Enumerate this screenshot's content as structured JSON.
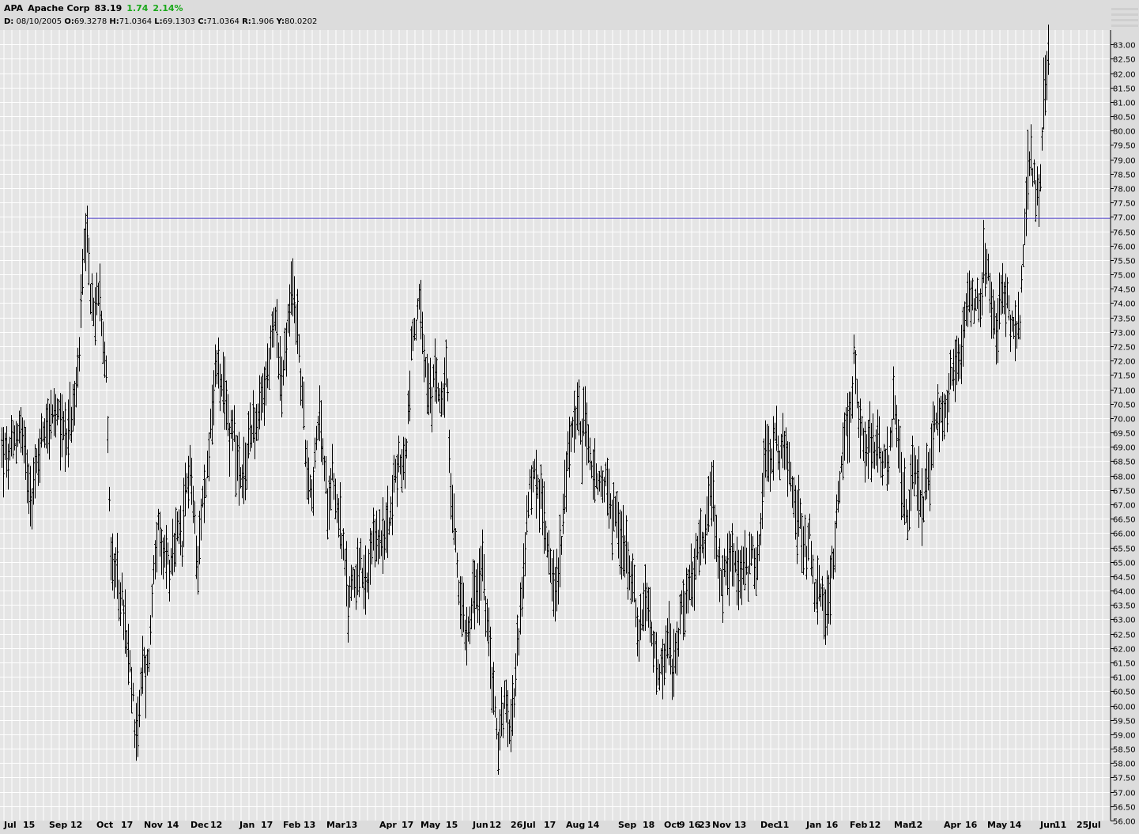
{
  "header": {
    "symbol": "APA",
    "name": "Apache Corp",
    "last": "83.19",
    "change": "1.74",
    "change_pct": "2.14%",
    "change_color": "#1aa81a",
    "ohlc": {
      "d_label": "D:",
      "d": "08/10/2005",
      "o_label": "O:",
      "o": "69.3278",
      "h_label": "H:",
      "h": "71.0364",
      "l_label": "L:",
      "l": "69.1303",
      "c_label": "C:",
      "c": "71.0364",
      "r_label": "R:",
      "r": "1.906",
      "y_label": "Y:",
      "y": "80.0202"
    }
  },
  "chart_data": {
    "type": "bar",
    "subtype": "ohlc",
    "ylim": [
      56.0,
      83.5
    ],
    "y_ticks": [
      "56.00",
      "56.50",
      "57.00",
      "57.50",
      "58.00",
      "58.50",
      "59.00",
      "59.50",
      "60.00",
      "60.50",
      "61.00",
      "61.50",
      "62.00",
      "62.50",
      "63.00",
      "63.50",
      "64.00",
      "64.50",
      "65.00",
      "65.50",
      "66.00",
      "66.50",
      "67.00",
      "67.50",
      "68.00",
      "68.50",
      "69.00",
      "69.50",
      "70.00",
      "70.50",
      "71.00",
      "71.50",
      "72.00",
      "72.50",
      "73.00",
      "73.50",
      "74.00",
      "74.50",
      "75.00",
      "75.50",
      "76.00",
      "76.50",
      "77.00",
      "77.50",
      "78.00",
      "78.50",
      "79.00",
      "79.50",
      "80.00",
      "80.50",
      "81.00",
      "81.50",
      "82.00",
      "82.50",
      "83.00"
    ],
    "x_tick_labels": [
      "Jul",
      "15",
      "Sep",
      "12",
      "Oct",
      "17",
      "Nov",
      "14",
      "Dec",
      "12",
      "Jan",
      "17",
      "Feb",
      "13",
      "Mar",
      "13",
      "Apr",
      "17",
      "May",
      "15",
      "Jun",
      "12",
      "26",
      "Jul",
      "17",
      "Aug",
      "14",
      "Sep",
      "18",
      "Oct",
      "9",
      "16",
      "23",
      "Nov",
      "13",
      "Dec",
      "11",
      "Jan",
      "16",
      "Feb",
      "12",
      "Mar",
      "12",
      "Apr",
      "16",
      "May",
      "14",
      "Jun",
      "11",
      "25",
      "Jul"
    ],
    "grid": true,
    "legend": "none",
    "resistance_line": {
      "value": 76.95,
      "color": "#4b3cc8"
    },
    "series_anchors": [
      [
        0,
        69.0
      ],
      [
        10,
        68.5
      ],
      [
        25,
        69.8
      ],
      [
        40,
        67.3
      ],
      [
        55,
        69.8
      ],
      [
        70,
        70.0
      ],
      [
        85,
        69.5
      ],
      [
        95,
        70.5
      ],
      [
        100,
        72.5
      ],
      [
        105,
        75.5
      ],
      [
        110,
        76.0
      ],
      [
        115,
        74.0
      ],
      [
        120,
        73.5
      ],
      [
        125,
        75.0
      ],
      [
        130,
        73.0
      ],
      [
        135,
        71.0
      ],
      [
        140,
        65.0
      ],
      [
        145,
        64.5
      ],
      [
        150,
        64.0
      ],
      [
        155,
        63.5
      ],
      [
        160,
        62.0
      ],
      [
        165,
        61.0
      ],
      [
        170,
        59.5
      ],
      [
        175,
        59.2
      ],
      [
        180,
        61.5
      ],
      [
        185,
        61.0
      ],
      [
        190,
        62.5
      ],
      [
        195,
        65.5
      ],
      [
        200,
        66.0
      ],
      [
        205,
        65.0
      ],
      [
        210,
        65.5
      ],
      [
        215,
        64.5
      ],
      [
        220,
        65.3
      ],
      [
        225,
        66.0
      ],
      [
        230,
        65.5
      ],
      [
        235,
        67.5
      ],
      [
        240,
        68.5
      ],
      [
        245,
        66.5
      ],
      [
        250,
        65.2
      ],
      [
        255,
        67.0
      ],
      [
        260,
        67.5
      ],
      [
        265,
        69.5
      ],
      [
        270,
        70.8
      ],
      [
        275,
        72.3
      ],
      [
        280,
        70.8
      ],
      [
        285,
        70.5
      ],
      [
        290,
        69.5
      ],
      [
        295,
        70.0
      ],
      [
        300,
        68.2
      ],
      [
        305,
        67.5
      ],
      [
        310,
        68.0
      ],
      [
        315,
        69.5
      ],
      [
        320,
        70.0
      ],
      [
        325,
        69.5
      ],
      [
        330,
        70.5
      ],
      [
        335,
        71.0
      ],
      [
        340,
        72.0
      ],
      [
        345,
        73.0
      ],
      [
        350,
        73.5
      ],
      [
        355,
        71.0
      ],
      [
        360,
        72.0
      ],
      [
        365,
        73.5
      ],
      [
        370,
        74.5
      ],
      [
        375,
        73.5
      ],
      [
        380,
        71.5
      ],
      [
        385,
        69.5
      ],
      [
        390,
        68.0
      ],
      [
        395,
        67.5
      ],
      [
        400,
        69.0
      ],
      [
        405,
        70.2
      ],
      [
        410,
        68.0
      ],
      [
        415,
        67.0
      ],
      [
        420,
        68.5
      ],
      [
        425,
        67.0
      ],
      [
        430,
        66.5
      ],
      [
        435,
        65.0
      ],
      [
        440,
        63.5
      ],
      [
        445,
        64.5
      ],
      [
        450,
        64.5
      ],
      [
        455,
        65.0
      ],
      [
        460,
        64.0
      ],
      [
        465,
        64.2
      ],
      [
        470,
        65.2
      ],
      [
        475,
        66.0
      ],
      [
        480,
        65.8
      ],
      [
        485,
        65.5
      ],
      [
        490,
        66.5
      ],
      [
        495,
        67.0
      ],
      [
        500,
        68.0
      ],
      [
        505,
        68.5
      ],
      [
        510,
        68.2
      ],
      [
        515,
        69.5
      ],
      [
        520,
        72.5
      ],
      [
        525,
        73.2
      ],
      [
        530,
        74.0
      ],
      [
        535,
        72.5
      ],
      [
        540,
        71.0
      ],
      [
        545,
        70.5
      ],
      [
        550,
        71.5
      ],
      [
        555,
        71.0
      ],
      [
        560,
        70.8
      ],
      [
        565,
        71.5
      ],
      [
        570,
        67.0
      ],
      [
        575,
        66.0
      ],
      [
        580,
        64.0
      ],
      [
        585,
        63.5
      ],
      [
        590,
        62.5
      ],
      [
        595,
        63.5
      ],
      [
        600,
        64.0
      ],
      [
        605,
        63.8
      ],
      [
        610,
        65.0
      ],
      [
        615,
        63.0
      ],
      [
        620,
        61.5
      ],
      [
        625,
        60.5
      ],
      [
        630,
        58.2
      ],
      [
        635,
        60.0
      ],
      [
        640,
        59.8
      ],
      [
        645,
        59.5
      ],
      [
        650,
        60.5
      ],
      [
        655,
        62.5
      ],
      [
        660,
        63.5
      ],
      [
        665,
        66.0
      ],
      [
        670,
        67.5
      ],
      [
        675,
        68.2
      ],
      [
        680,
        67.5
      ],
      [
        685,
        67.0
      ],
      [
        690,
        66.2
      ],
      [
        695,
        65.5
      ],
      [
        700,
        64.0
      ],
      [
        705,
        64.2
      ],
      [
        710,
        66.0
      ],
      [
        715,
        67.5
      ],
      [
        720,
        69.0
      ],
      [
        725,
        70.0
      ],
      [
        730,
        70.5
      ],
      [
        735,
        69.0
      ],
      [
        740,
        70.5
      ],
      [
        745,
        68.5
      ],
      [
        750,
        68.2
      ],
      [
        755,
        67.5
      ],
      [
        760,
        67.5
      ],
      [
        765,
        68.0
      ],
      [
        770,
        67.0
      ],
      [
        775,
        66.5
      ],
      [
        780,
        67.0
      ],
      [
        785,
        65.5
      ],
      [
        790,
        65.5
      ],
      [
        795,
        65.0
      ],
      [
        800,
        64.5
      ],
      [
        805,
        63.0
      ],
      [
        810,
        62.5
      ],
      [
        815,
        63.3
      ],
      [
        820,
        63.5
      ],
      [
        825,
        62.0
      ],
      [
        830,
        61.5
      ],
      [
        835,
        61.0
      ],
      [
        840,
        61.3
      ],
      [
        845,
        62.5
      ],
      [
        850,
        61.2
      ],
      [
        855,
        61.5
      ],
      [
        860,
        63.0
      ],
      [
        865,
        63.5
      ],
      [
        870,
        64.0
      ],
      [
        875,
        64.3
      ],
      [
        880,
        65.0
      ],
      [
        885,
        65.3
      ],
      [
        890,
        65.5
      ],
      [
        895,
        67.0
      ],
      [
        900,
        67.5
      ],
      [
        905,
        65.8
      ],
      [
        910,
        64.2
      ],
      [
        915,
        64.5
      ],
      [
        920,
        65.0
      ],
      [
        925,
        65.3
      ],
      [
        930,
        64.8
      ],
      [
        935,
        64.2
      ],
      [
        940,
        65.0
      ],
      [
        945,
        64.5
      ],
      [
        950,
        65.5
      ],
      [
        955,
        65.0
      ],
      [
        960,
        65.5
      ],
      [
        965,
        68.0
      ],
      [
        970,
        69.0
      ],
      [
        975,
        68.5
      ],
      [
        980,
        69.5
      ],
      [
        985,
        68.5
      ],
      [
        990,
        69.0
      ],
      [
        995,
        68.5
      ],
      [
        1000,
        68.0
      ],
      [
        1005,
        66.8
      ],
      [
        1010,
        66.5
      ],
      [
        1015,
        66.2
      ],
      [
        1020,
        65.5
      ],
      [
        1025,
        66.0
      ],
      [
        1030,
        63.5
      ],
      [
        1035,
        64.2
      ],
      [
        1040,
        63.5
      ],
      [
        1045,
        63.0
      ],
      [
        1050,
        64.5
      ],
      [
        1055,
        65.5
      ],
      [
        1060,
        67.5
      ],
      [
        1065,
        68.5
      ],
      [
        1070,
        70.0
      ],
      [
        1075,
        69.8
      ],
      [
        1080,
        72.0
      ],
      [
        1085,
        70.5
      ],
      [
        1090,
        69.5
      ],
      [
        1095,
        69.0
      ],
      [
        1100,
        69.5
      ],
      [
        1105,
        69.0
      ],
      [
        1110,
        69.5
      ],
      [
        1115,
        68.0
      ],
      [
        1120,
        69.0
      ],
      [
        1125,
        68.5
      ],
      [
        1130,
        70.5
      ],
      [
        1135,
        69.0
      ],
      [
        1140,
        68.0
      ],
      [
        1145,
        67.0
      ],
      [
        1150,
        66.5
      ],
      [
        1155,
        68.5
      ],
      [
        1160,
        68.0
      ],
      [
        1165,
        67.0
      ],
      [
        1170,
        67.5
      ],
      [
        1175,
        68.0
      ],
      [
        1180,
        69.5
      ],
      [
        1185,
        69.8
      ],
      [
        1190,
        70.2
      ],
      [
        1195,
        70.0
      ],
      [
        1200,
        71.0
      ],
      [
        1205,
        71.5
      ],
      [
        1210,
        71.8
      ],
      [
        1215,
        72.5
      ],
      [
        1220,
        73.5
      ],
      [
        1225,
        74.5
      ],
      [
        1230,
        74.0
      ],
      [
        1235,
        74.5
      ],
      [
        1240,
        74.0
      ],
      [
        1245,
        75.5
      ],
      [
        1250,
        75.0
      ],
      [
        1255,
        73.5
      ],
      [
        1260,
        73.0
      ],
      [
        1265,
        74.0
      ],
      [
        1270,
        74.5
      ],
      [
        1275,
        74.2
      ],
      [
        1280,
        73.0
      ],
      [
        1285,
        73.2
      ],
      [
        1290,
        73.5
      ],
      [
        1295,
        76.5
      ],
      [
        1300,
        78.5
      ],
      [
        1305,
        79.0
      ],
      [
        1310,
        77.8
      ],
      [
        1315,
        77.5
      ],
      [
        1320,
        81.0
      ],
      [
        1325,
        82.0
      ],
      [
        1327,
        83.19
      ]
    ]
  }
}
